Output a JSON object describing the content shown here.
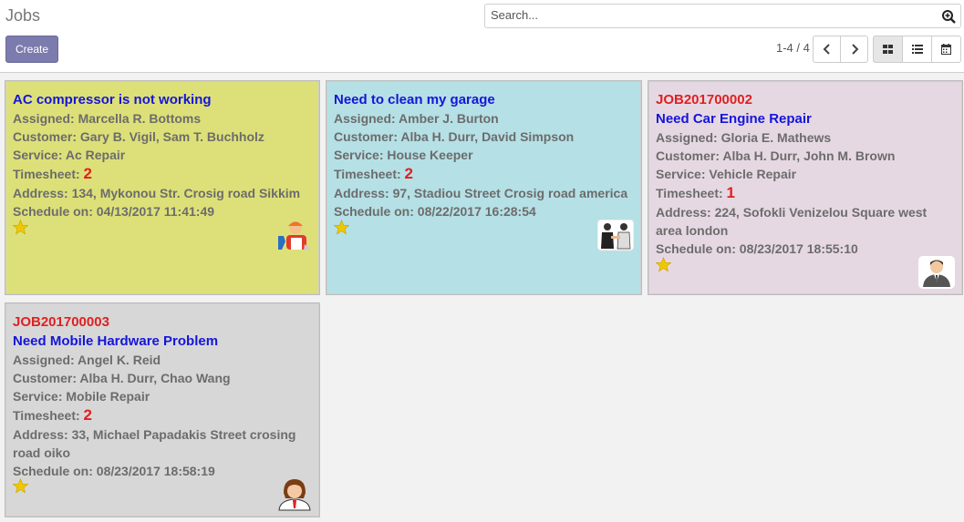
{
  "header": {
    "title": "Jobs",
    "search_placeholder": "Search...",
    "create_label": "Create",
    "pager_text": "1-4 / 4"
  },
  "cards": [
    {
      "name": "AC compressor is not working",
      "assigned": "Marcella R. Bottoms",
      "customer": "Gary B. Vigil, Sam T. Buchholz",
      "service": "Ac Repair",
      "timesheet": "2",
      "address": "134, Mykonou Str. Crosig road Sikkim",
      "schedule": "04/13/2017 11:41:49",
      "bg": "#dde078",
      "avatar": "repairman-avatar"
    },
    {
      "name": "Need to clean my garage",
      "assigned": "Amber J. Burton",
      "customer": "Alba H. Durr, David Simpson",
      "service": "House Keeper",
      "timesheet": "2",
      "address": "97, Stadiou Street Crosig road america",
      "schedule": "08/22/2017 16:28:54",
      "bg": "#b5e0e5",
      "avatar": "handshake-avatar"
    },
    {
      "job_no": "JOB201700002",
      "name": "Need Car Engine Repair",
      "assigned": "Gloria E. Mathews",
      "customer": "Alba H. Durr, John M. Brown",
      "service": "Vehicle Repair",
      "timesheet": "1",
      "address": "224, Sofokli Venizelou Square west area london",
      "schedule": "08/23/2017 18:55:10",
      "bg": "#e6d8e3",
      "avatar": "businessman-avatar"
    },
    {
      "job_no": "JOB201700003",
      "name": "Need Mobile Hardware Problem",
      "assigned": "Angel K. Reid",
      "customer": "Alba H. Durr, Chao Wang",
      "service": "Mobile Repair",
      "timesheet": "2",
      "address": "33, Michael Papadakis Street crosing road oiko",
      "schedule": "08/23/2017 18:58:19",
      "bg": "#d7d7d7",
      "avatar": "woman-avatar"
    }
  ],
  "labels": {
    "assigned": "Assigned: ",
    "customer": "Customer: ",
    "service": "Service: ",
    "timesheet": "Timesheet: ",
    "address": "Address: ",
    "schedule": "Schedule on: "
  },
  "colors": {
    "accent": "#7c7bad",
    "star": "#f0c800",
    "job_number": "#e02020",
    "job_name": "#1515d9"
  }
}
